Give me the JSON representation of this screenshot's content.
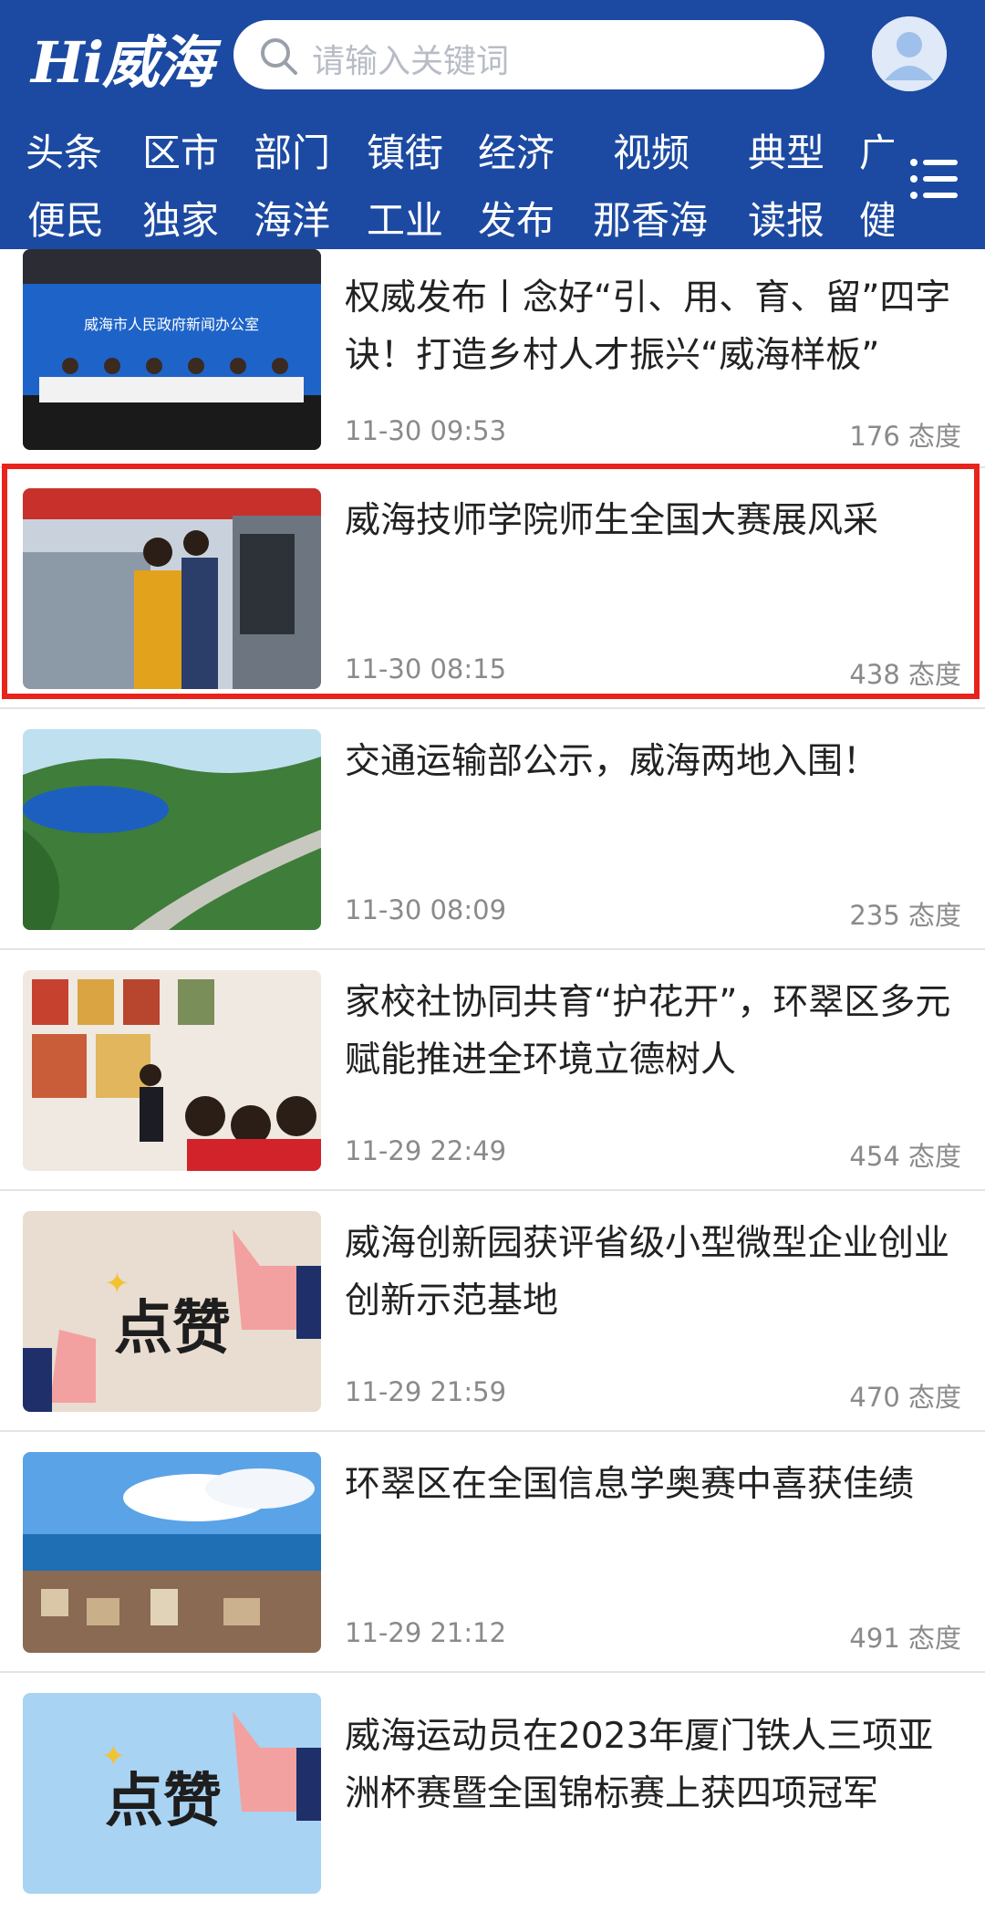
{
  "header": {
    "logo": "Hi威海",
    "search_placeholder": "请输入关键词",
    "nav_row1": [
      "头条",
      "区市",
      "部门",
      "镇街",
      "经济",
      "视频",
      "典型",
      "广"
    ],
    "nav_row2": [
      "便民",
      "独家",
      "海洋",
      "工业",
      "发布",
      "那香海",
      "读报",
      "健"
    ]
  },
  "articles": [
    {
      "title": "权威发布丨念好“引、用、育、留”四字诀！打造乡村人才振兴“威海样板”",
      "time": "11-30 09:53",
      "score": "176 态度"
    },
    {
      "title": "威海技师学院师生全国大赛展风采",
      "time": "11-30 08:15",
      "score": "438 态度"
    },
    {
      "title": "交通运输部公示，威海两地入围！",
      "time": "11-30 08:09",
      "score": "235 态度"
    },
    {
      "title": "家校社协同共育“护花开”，环翠区多元赋能推进全环境立德树人",
      "time": "11-29 22:49",
      "score": "454 态度"
    },
    {
      "title": "威海创新园获评省级小型微型企业创业创新示范基地",
      "time": "11-29 21:59",
      "score": "470 态度"
    },
    {
      "title": "环翠区在全国信息学奥赛中喜获佳绩",
      "time": "11-29 21:12",
      "score": "491 态度"
    },
    {
      "title": "威海运动员在2023年厦门铁人三项亚洲杯赛暨全国锦标赛上获四项冠军",
      "time": "",
      "score": ""
    }
  ],
  "thumbs": {
    "like_text": "点赞",
    "press_banner": "威海市人民政府新闻办公室"
  },
  "colors": {
    "header": "#1c4aa2",
    "highlight": "#e8231b"
  }
}
